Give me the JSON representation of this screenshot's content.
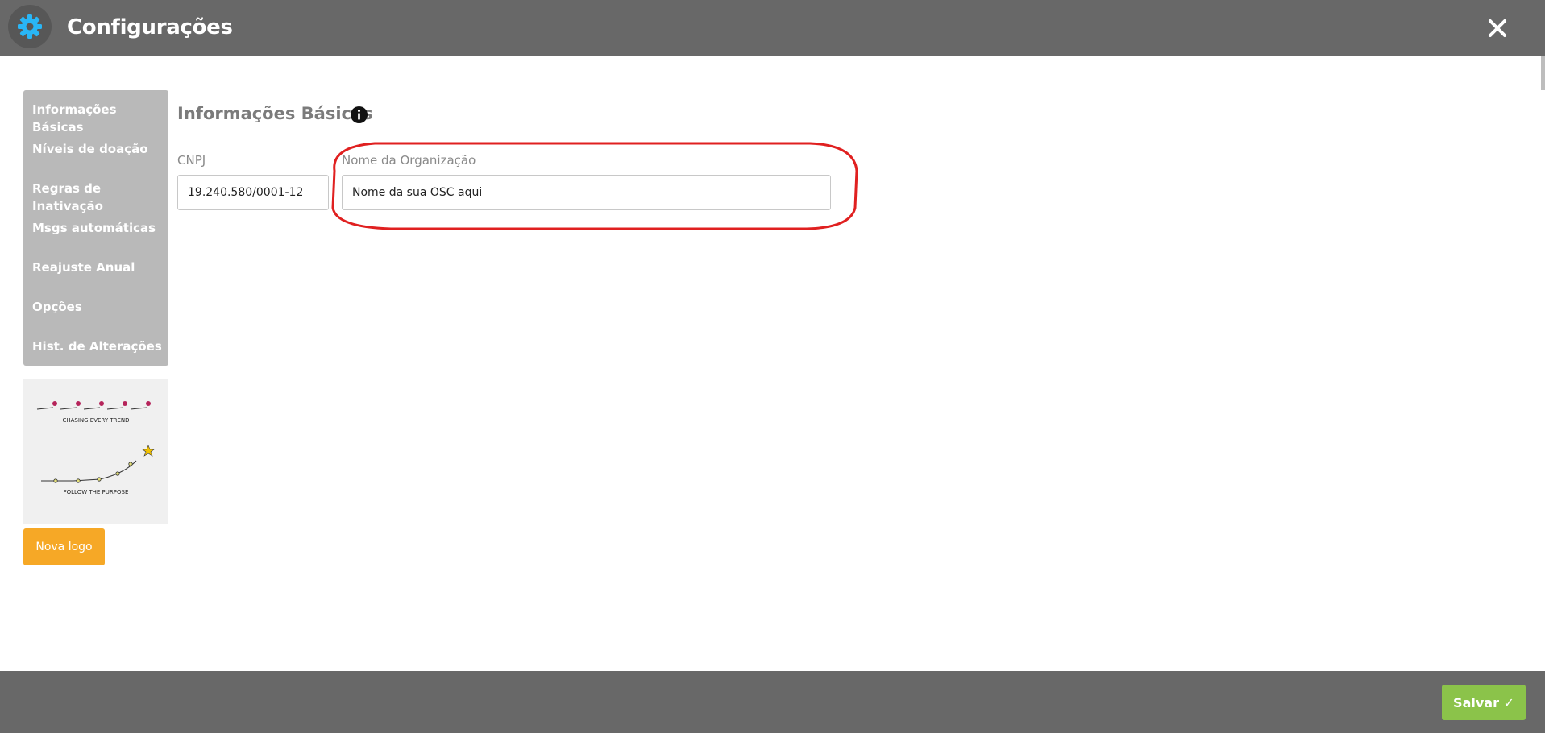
{
  "window": {
    "title": "Configurações",
    "close_icon": "close-icon"
  },
  "sidebar": {
    "items": [
      {
        "label": "Informações Básicas"
      },
      {
        "label": "Níveis de doação"
      },
      {
        "label": "Regras de Inativação"
      },
      {
        "label": "Msgs automáticas"
      },
      {
        "label": "Reajuste Anual"
      },
      {
        "label": "Opções"
      },
      {
        "label": "Hist. de Alterações"
      }
    ]
  },
  "logo": {
    "caption_top": "CHASING EVERY TREND",
    "caption_bottom": "FOLLOW THE PURPOSE",
    "button_label": "Nova logo"
  },
  "main": {
    "section_title": "Informações Básicas",
    "cnpj_label": "CNPJ",
    "cnpj_value": "19.240.580/0001-12",
    "org_label": "Nome da Organização",
    "org_value": "Nome da sua OSC aqui"
  },
  "footer": {
    "save_label": "Salvar ✓"
  },
  "colors": {
    "header_bg": "#686868",
    "gear_accent": "#29b6f6",
    "sidebar_bg": "#b9b9b9",
    "logo_button": "#f6a826",
    "save_button": "#8bc34a",
    "annotation": "#e02020"
  }
}
